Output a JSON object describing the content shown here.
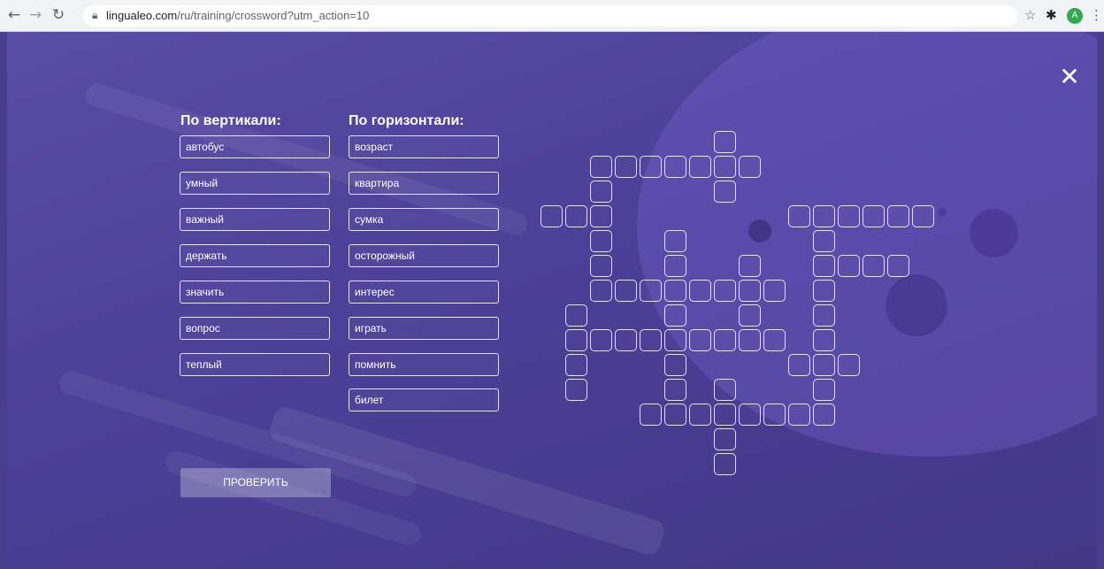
{
  "browser": {
    "url_host": "lingualeo.com",
    "url_path": "/ru/training/crossword?utm_action=10",
    "avatar_letter": "A"
  },
  "close_label": "✕",
  "vertical": {
    "title": "По вертикали:",
    "words": [
      "автобус",
      "умный",
      "важный",
      "держать",
      "значить",
      "вопрос",
      "теплый"
    ]
  },
  "horizontal": {
    "title": "По горизонтали:",
    "words": [
      "возраст",
      "квартира",
      "сумка",
      "осторожный",
      "интерес",
      "играть",
      "помнить",
      "билет"
    ]
  },
  "check_button": "ПРОВЕРИТЬ",
  "crossword": {
    "grid_columns": 16,
    "grid_rows": 14,
    "cells": [
      [
        7,
        0
      ],
      [
        2,
        1
      ],
      [
        3,
        1
      ],
      [
        4,
        1
      ],
      [
        5,
        1
      ],
      [
        6,
        1
      ],
      [
        7,
        1
      ],
      [
        8,
        1
      ],
      [
        2,
        2
      ],
      [
        7,
        2
      ],
      [
        0,
        3
      ],
      [
        1,
        3
      ],
      [
        2,
        3
      ],
      [
        10,
        3
      ],
      [
        11,
        3
      ],
      [
        12,
        3
      ],
      [
        13,
        3
      ],
      [
        14,
        3
      ],
      [
        15,
        3
      ],
      [
        2,
        4
      ],
      [
        5,
        4
      ],
      [
        11,
        4
      ],
      [
        2,
        5
      ],
      [
        5,
        5
      ],
      [
        8,
        5
      ],
      [
        11,
        5
      ],
      [
        12,
        5
      ],
      [
        13,
        5
      ],
      [
        14,
        5
      ],
      [
        2,
        6
      ],
      [
        3,
        6
      ],
      [
        4,
        6
      ],
      [
        5,
        6
      ],
      [
        6,
        6
      ],
      [
        7,
        6
      ],
      [
        8,
        6
      ],
      [
        9,
        6
      ],
      [
        11,
        6
      ],
      [
        1,
        7
      ],
      [
        5,
        7
      ],
      [
        8,
        7
      ],
      [
        11,
        7
      ],
      [
        1,
        8
      ],
      [
        2,
        8
      ],
      [
        3,
        8
      ],
      [
        4,
        8
      ],
      [
        5,
        8
      ],
      [
        6,
        8
      ],
      [
        7,
        8
      ],
      [
        8,
        8
      ],
      [
        9,
        8
      ],
      [
        11,
        8
      ],
      [
        1,
        9
      ],
      [
        5,
        9
      ],
      [
        10,
        9
      ],
      [
        11,
        9
      ],
      [
        12,
        9
      ],
      [
        1,
        10
      ],
      [
        5,
        10
      ],
      [
        7,
        10
      ],
      [
        11,
        10
      ],
      [
        4,
        11
      ],
      [
        5,
        11
      ],
      [
        6,
        11
      ],
      [
        7,
        11
      ],
      [
        8,
        11
      ],
      [
        9,
        11
      ],
      [
        10,
        11
      ],
      [
        11,
        11
      ],
      [
        7,
        12
      ],
      [
        7,
        13
      ]
    ]
  }
}
